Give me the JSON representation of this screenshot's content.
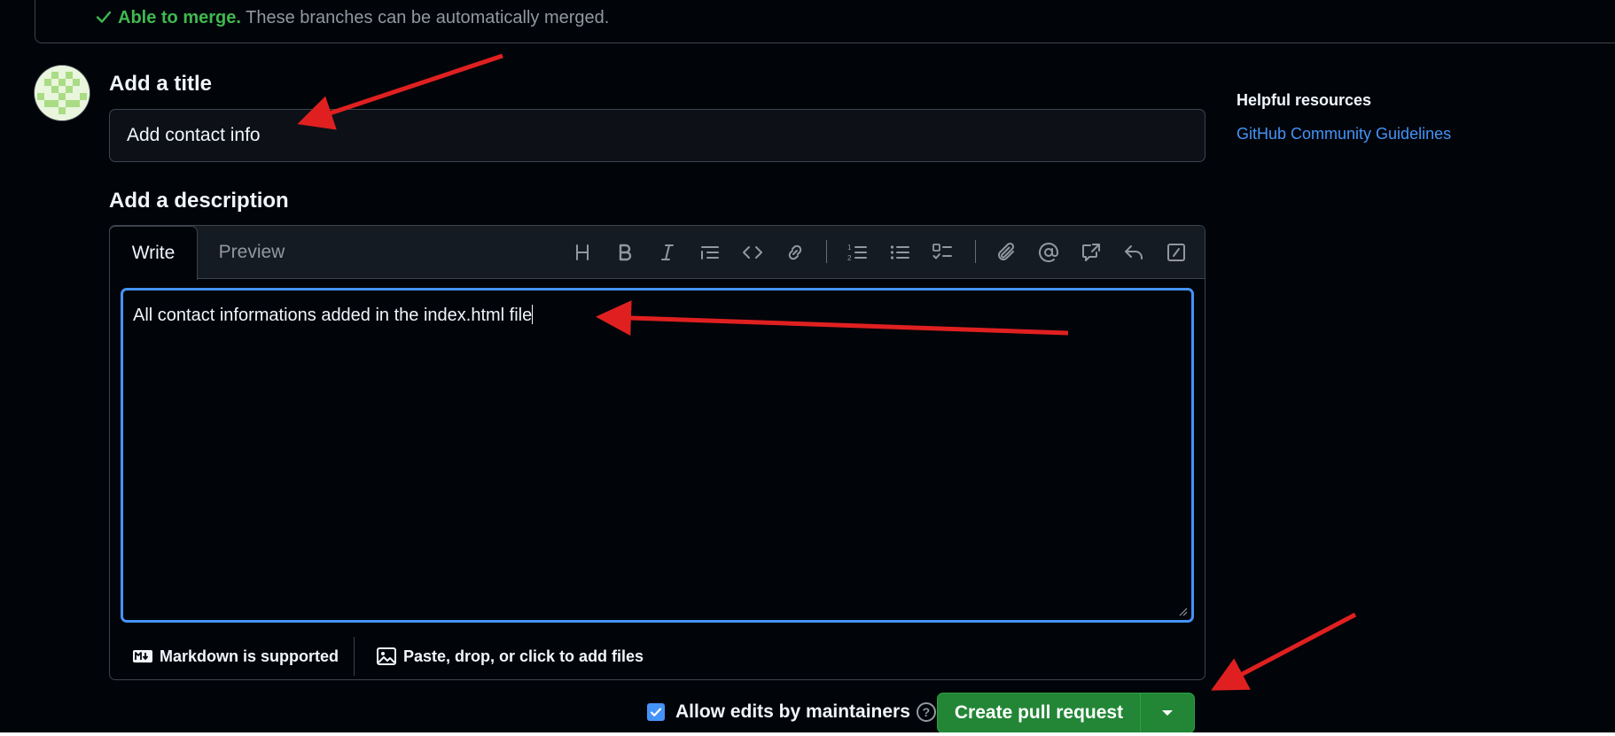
{
  "merge_status": {
    "status_label": "Able to merge.",
    "message": "These branches can be automatically merged.",
    "color": "#3fb950"
  },
  "avatar": {
    "icon": "identicon-avatar"
  },
  "title_section": {
    "heading": "Add a title",
    "value": "Add contact info"
  },
  "description_section": {
    "heading": "Add a description",
    "tabs": [
      {
        "label": "Write",
        "active": true
      },
      {
        "label": "Preview",
        "active": false
      }
    ],
    "toolbar": [
      "heading-icon",
      "bold-icon",
      "italic-icon",
      "quote-icon",
      "code-icon",
      "link-icon",
      "numbered-list-icon",
      "unordered-list-icon",
      "task-list-icon",
      "attach-icon",
      "mention-icon",
      "cross-reference-icon",
      "saved-reply-icon",
      "slash-command-icon"
    ],
    "body": "All contact informations added in the index.html file",
    "markdown_note": "Markdown is supported",
    "attach_note": "Paste, drop, or click to add files"
  },
  "actions": {
    "allow_edits_label": "Allow edits by maintainers",
    "allow_edits_checked": true,
    "create_label": "Create pull request",
    "button_color": "#238636"
  },
  "sidebar": {
    "heading": "Helpful resources",
    "link": "GitHub Community Guidelines"
  },
  "annotations": {
    "arrow_color": "#e02020",
    "count": 3
  }
}
